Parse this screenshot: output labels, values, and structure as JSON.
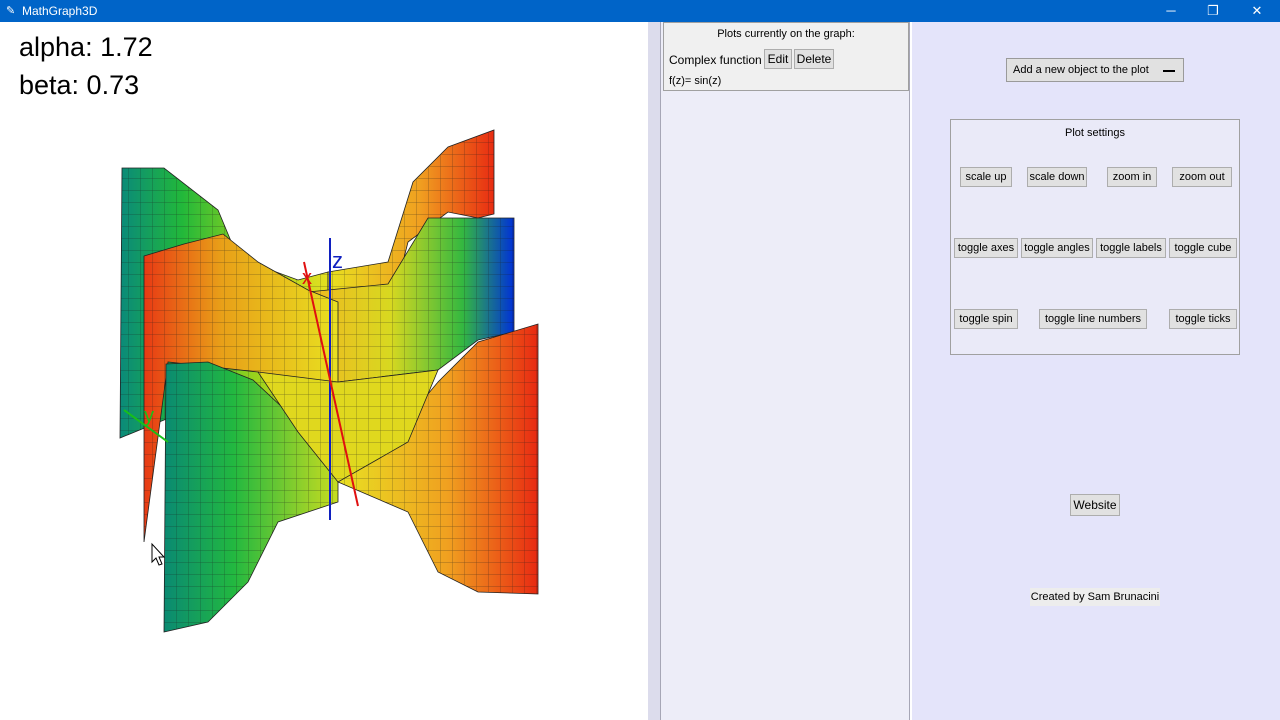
{
  "window": {
    "title": "MathGraph3D",
    "minimize_glyph": "─",
    "restore_glyph": "❐",
    "close_glyph": "✕",
    "app_icon": "pen-icon"
  },
  "readout": {
    "alpha": "alpha: 1.72",
    "beta": "beta: 0.73"
  },
  "axes": {
    "x": "x",
    "y": "y",
    "z": "z"
  },
  "plots_panel": {
    "title": "Plots currently on the graph:",
    "items": [
      {
        "type": "Complex function",
        "edit": "Edit",
        "delete": "Delete",
        "formula": "f(z)= sin(z)"
      }
    ]
  },
  "add_object": {
    "label": "Add a new object to the plot",
    "icon": "dash-icon"
  },
  "settings": {
    "title": "Plot settings",
    "row1": [
      "scale up",
      "scale down",
      "zoom in",
      "zoom out"
    ],
    "row2": [
      "toggle axes",
      "toggle angles",
      "toggle labels",
      "toggle cube"
    ],
    "row3": [
      "toggle spin",
      "toggle line numbers",
      "toggle ticks"
    ]
  },
  "website": "Website",
  "credit": "Created by Sam Brunacini"
}
